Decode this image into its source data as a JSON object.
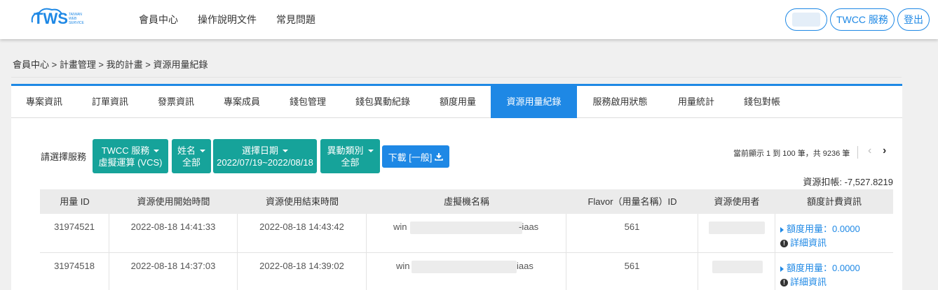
{
  "header": {
    "logo": "TWS",
    "logo_sub": "TAIWAN WEB SERVICE",
    "nav": [
      "會員中心",
      "操作說明文件",
      "常見問題"
    ],
    "twcc_button": "TWCC 服務",
    "logout_button": "登出"
  },
  "breadcrumb": "會員中心 > 計畫管理 > 我的計畫 > 資源用量紀錄",
  "tabs": [
    "專案資訊",
    "訂單資訊",
    "發票資訊",
    "專案成員",
    "錢包管理",
    "錢包異動紀錄",
    "額度用量",
    "資源用量紀錄",
    "服務啟用狀態",
    "用量統計",
    "錢包對帳"
  ],
  "active_tab": "資源用量紀錄",
  "filters": {
    "label": "請選擇服務",
    "service": {
      "line1": "TWCC 服務",
      "line2": "虛擬運算 (VCS)"
    },
    "name": {
      "line1": "姓名",
      "line2": "全部"
    },
    "date": {
      "line1": "選擇日期",
      "line2": "2022/07/19~2022/08/18"
    },
    "type": {
      "line1": "異動類別",
      "line2": "全部"
    },
    "download": "下載 [一般]"
  },
  "pagination": {
    "info": "當前顯示 1 到 100 筆，共 9236 筆",
    "prev": "‹",
    "next": "›"
  },
  "deduct": "資源扣帳: -7,527.8219",
  "table": {
    "headers": [
      "用量 ID",
      "資源使用開始時間",
      "資源使用結束時間",
      "虛擬機名稱",
      "Flavor（用量名稱）ID",
      "資源使用者",
      "額度計費資訊"
    ],
    "rows": [
      {
        "id": "31974521",
        "start": "2022-08-18 14:41:33",
        "end": "2022-08-18 14:43:42",
        "vm_prefix": "win",
        "vm_suffix": "-iaas",
        "flavor": "561",
        "quota": "額度用量：0.0000",
        "detail": "詳細資訊"
      },
      {
        "id": "31974518",
        "start": "2022-08-18 14:37:03",
        "end": "2022-08-18 14:39:02",
        "vm_prefix": "win",
        "vm_suffix": "iaas",
        "flavor": "561",
        "quota": "額度用量：0.0000",
        "detail": "詳細資訊"
      }
    ]
  },
  "colors": {
    "accent": "#1e88e5",
    "filter_teal": "#16a39a"
  }
}
